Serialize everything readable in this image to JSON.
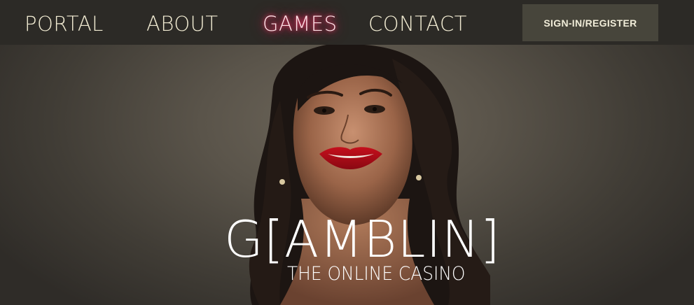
{
  "nav": {
    "links": [
      {
        "label": "PORTAL"
      },
      {
        "label": "ABOUT"
      },
      {
        "label": "GAMES",
        "active": true
      },
      {
        "label": "CONTACT"
      }
    ],
    "signin_label": "SIGN-IN/REGISTER"
  },
  "hero": {
    "brand": "G[AMBLIN]",
    "tagline": "THE ONLINE CASINO"
  },
  "colors": {
    "nav_background": "#2c2a26",
    "nav_text": "#f1ebd2",
    "active_glow": "#ff3b6b",
    "button_background": "#47453b"
  }
}
